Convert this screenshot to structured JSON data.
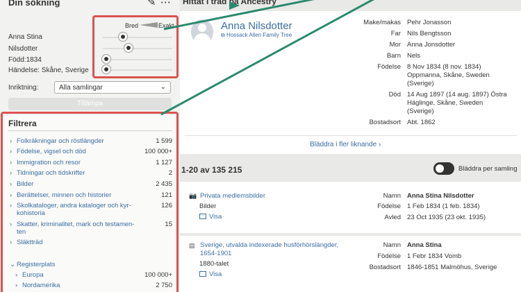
{
  "left": {
    "header": "Din sökning",
    "tools": "✎ ⋯",
    "scale": {
      "bred": "Bred",
      "exakt": "Exakt"
    },
    "params": [
      {
        "label": "Anna Stina"
      },
      {
        "label": "Nilsdotter"
      },
      {
        "label": "Född:1834"
      },
      {
        "label": "Händelse: Skåne, Sverige"
      }
    ],
    "direction_label": "Inriktning:",
    "direction_value": "Alla samlingar",
    "apply_label": "Tillämpa",
    "filter_title": "Filtrera",
    "filters": [
      {
        "label": "Folkräkningar och röstlängder",
        "count": "1 599"
      },
      {
        "label": "Födelse, vigsel och död",
        "count": "100 000+"
      },
      {
        "label": "Immigration och resor",
        "count": "1 127"
      },
      {
        "label": "Tidningar och tidskrifter",
        "count": "2"
      },
      {
        "label": "Bilder",
        "count": "2 435"
      },
      {
        "label": "Berättelser, minnen och historier",
        "count": "121"
      },
      {
        "label_line1": "Skolkataloger, andra kataloger och kyr-",
        "label_line2": "kohistoria",
        "count": "126"
      },
      {
        "label_line1": "Skatter, kriminalitet, mark och testamen-",
        "label_line2": "ten",
        "count": "15"
      },
      {
        "label": "Släktträd",
        "count": ""
      }
    ],
    "registry_label": "Registerplats",
    "registry": [
      {
        "label": "Europa",
        "count": "100 000+"
      },
      {
        "label": "Nordamerika",
        "count": "2 750"
      }
    ]
  },
  "right": {
    "header": "Hittat i träd på Ancestry",
    "person": {
      "name": "Anna Nilsdotter",
      "tree": "Hossack Allen Family Tree"
    },
    "facts": [
      {
        "label": "Make/makas",
        "value": "Pehr Jonasson"
      },
      {
        "label": "Far",
        "value": "Nils Bengtsson"
      },
      {
        "label": "Mor",
        "value": "Anna Jonsdotter"
      },
      {
        "label": "Barn",
        "value": "Nels"
      },
      {
        "label": "Födelse",
        "value": "8 Nov 1834 (8 nov. 1834) Oppmanna, Skåne, Sweden (Sverige)"
      },
      {
        "label": "Död",
        "value": "14 Aug 1897 (14 aug. 1897) Östra Häglinge, Skåne, Sweden (Sverige)"
      },
      {
        "label": "Bostadsort",
        "value": "Abt. 1862"
      }
    ],
    "browse_more": "Bläddra i fler liknande ›",
    "results_count": "1-20 av 135 215",
    "toggle_label": "Bläddra per samling",
    "results": [
      {
        "title": "Privata medlemsbilder",
        "sub": "Bilder",
        "visa": "Visa",
        "rows": [
          {
            "label": "Namn",
            "value": "Anna Stina Nilsdotter"
          },
          {
            "label": "Födelse",
            "value": "1 Feb 1834 (1 feb. 1834)"
          },
          {
            "label": "Avled",
            "value": "23 Oct 1935 (23 okt. 1935)"
          }
        ]
      },
      {
        "title": "Sverige, utvalda indexerade husförhörslängder, 1654-1901",
        "sub": "1880-talet",
        "visa": "Visa",
        "rows": [
          {
            "label": "Namn",
            "value": "Anna Stina"
          },
          {
            "label": "Födelse",
            "value": "1 Febr 1834 Vomb"
          },
          {
            "label": "Bostadsort",
            "value": "1846-1851 Malmöhus, Sverige"
          }
        ]
      }
    ]
  },
  "colors": {
    "highlight": "#d9534f",
    "arrow": "#2a8a6e",
    "link": "#3a6ea5"
  }
}
